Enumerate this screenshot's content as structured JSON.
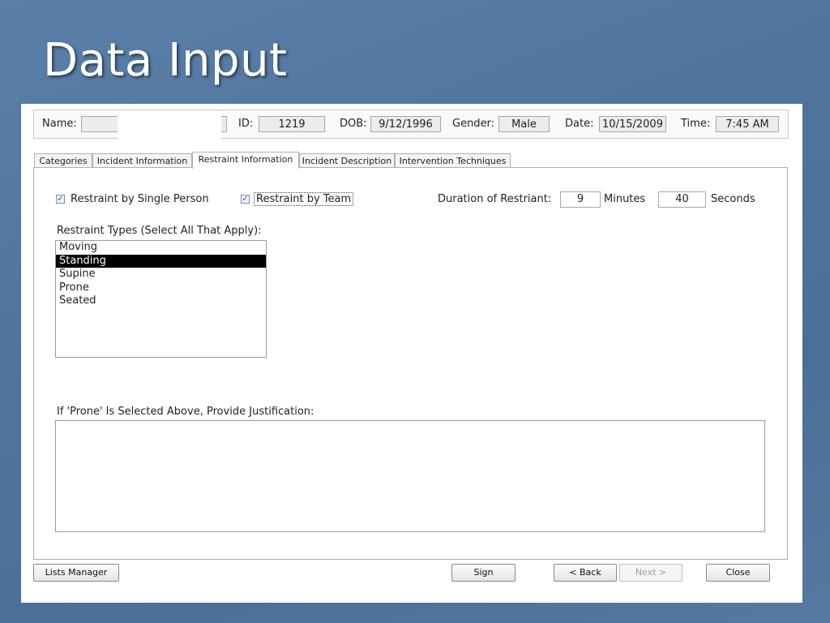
{
  "slide": {
    "title": "Data Input"
  },
  "header": {
    "name_label": "Name:",
    "name_value": "",
    "id_label": "ID:",
    "id_value": "1219",
    "dob_label": "DOB:",
    "dob_value": "9/12/1996",
    "gender_label": "Gender:",
    "gender_value": "Male",
    "date_label": "Date:",
    "date_value": "10/15/2009",
    "time_label": "Time:",
    "time_value": "7:45 AM"
  },
  "tabs": [
    {
      "label": "Categories",
      "active": false
    },
    {
      "label": "Incident Information",
      "active": false
    },
    {
      "label": "Restraint Information",
      "active": true
    },
    {
      "label": "Incident Description",
      "active": false
    },
    {
      "label": "Intervention Techniques",
      "active": false
    }
  ],
  "restraint": {
    "single_person_label": "Restraint by Single Person",
    "single_person_checked": true,
    "team_label": "Restraint by Team",
    "team_checked": true,
    "duration_label": "Duration of Restriant:",
    "minutes_value": "9",
    "minutes_label": "Minutes",
    "seconds_value": "40",
    "seconds_label": "Seconds"
  },
  "types": {
    "label": "Restraint Types (Select All That Apply):",
    "options": [
      "Moving",
      "Standing",
      "Supine",
      "Prone",
      "Seated"
    ],
    "selected": "Standing"
  },
  "justification": {
    "label": "If 'Prone' Is Selected Above, Provide Justification:",
    "value": ""
  },
  "buttons": {
    "lists_manager": "Lists Manager",
    "sign": "Sign",
    "back": "< Back",
    "next": "Next >",
    "close": "Close"
  },
  "colors": {
    "background": "#4f759f",
    "selected_item": "#000000"
  }
}
